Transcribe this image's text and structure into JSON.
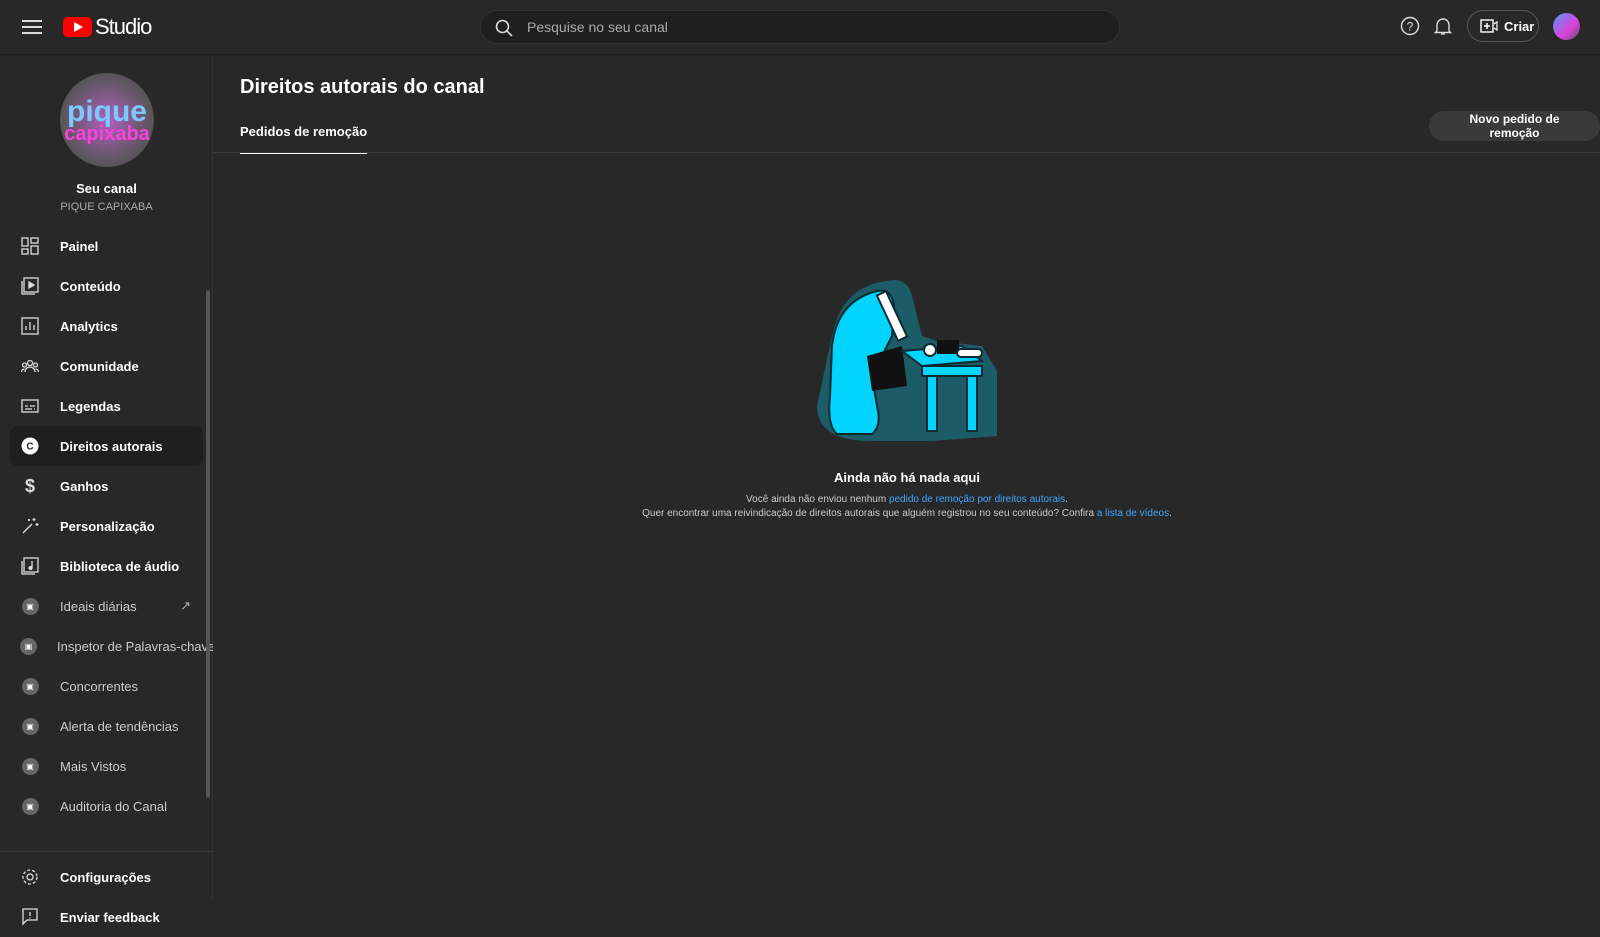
{
  "header": {
    "logo_text": "Studio",
    "search_placeholder": "Pesquise no seu canal",
    "create_label": "Criar"
  },
  "channel": {
    "avatar_line1": "pique",
    "avatar_line2": "capixaba",
    "title": "Seu canal",
    "name": "PIQUE CAPIXABA"
  },
  "sidebar": {
    "items": [
      {
        "label": "Painel",
        "icon": "dashboard-icon"
      },
      {
        "label": "Conteúdo",
        "icon": "content-icon"
      },
      {
        "label": "Analytics",
        "icon": "analytics-icon"
      },
      {
        "label": "Comunidade",
        "icon": "community-icon"
      },
      {
        "label": "Legendas",
        "icon": "subtitles-icon"
      },
      {
        "label": "Direitos autorais",
        "icon": "copyright-icon",
        "active": true
      },
      {
        "label": "Ganhos",
        "icon": "dollar-icon"
      },
      {
        "label": "Personalização",
        "icon": "magic-wand-icon"
      },
      {
        "label": "Biblioteca de áudio",
        "icon": "audio-library-icon"
      },
      {
        "label": "Ideais diárias",
        "icon": "extension-icon"
      },
      {
        "label": "Inspetor de Palavras-chave",
        "icon": "extension-icon"
      },
      {
        "label": "Concorrentes",
        "icon": "extension-icon"
      },
      {
        "label": "Alerta de tendências",
        "icon": "extension-icon"
      },
      {
        "label": "Mais Vistos",
        "icon": "extension-icon"
      },
      {
        "label": "Auditoria do Canal",
        "icon": "extension-icon"
      }
    ],
    "bottom": [
      {
        "label": "Configurações",
        "icon": "gear-icon"
      },
      {
        "label": "Enviar feedback",
        "icon": "feedback-icon"
      }
    ]
  },
  "main": {
    "title": "Direitos autorais do canal",
    "tab": "Pedidos de remoção",
    "new_request": "Novo pedido de remoção",
    "empty": {
      "heading": "Ainda não há nada aqui",
      "line1_prefix": "Você ainda não enviou nenhum ",
      "line1_link": "pedido de remoção por direitos autorais",
      "line1_suffix": ".",
      "line2_prefix": "Quer encontrar uma reivindicação de direitos autorais que alguém registrou no seu conteúdo? Confira ",
      "line2_link": "a lista de vídeos",
      "line2_suffix": "."
    }
  },
  "colors": {
    "accent": "#3ea6ff",
    "illustration": "#00d4ff",
    "brand": "#ff0000"
  }
}
